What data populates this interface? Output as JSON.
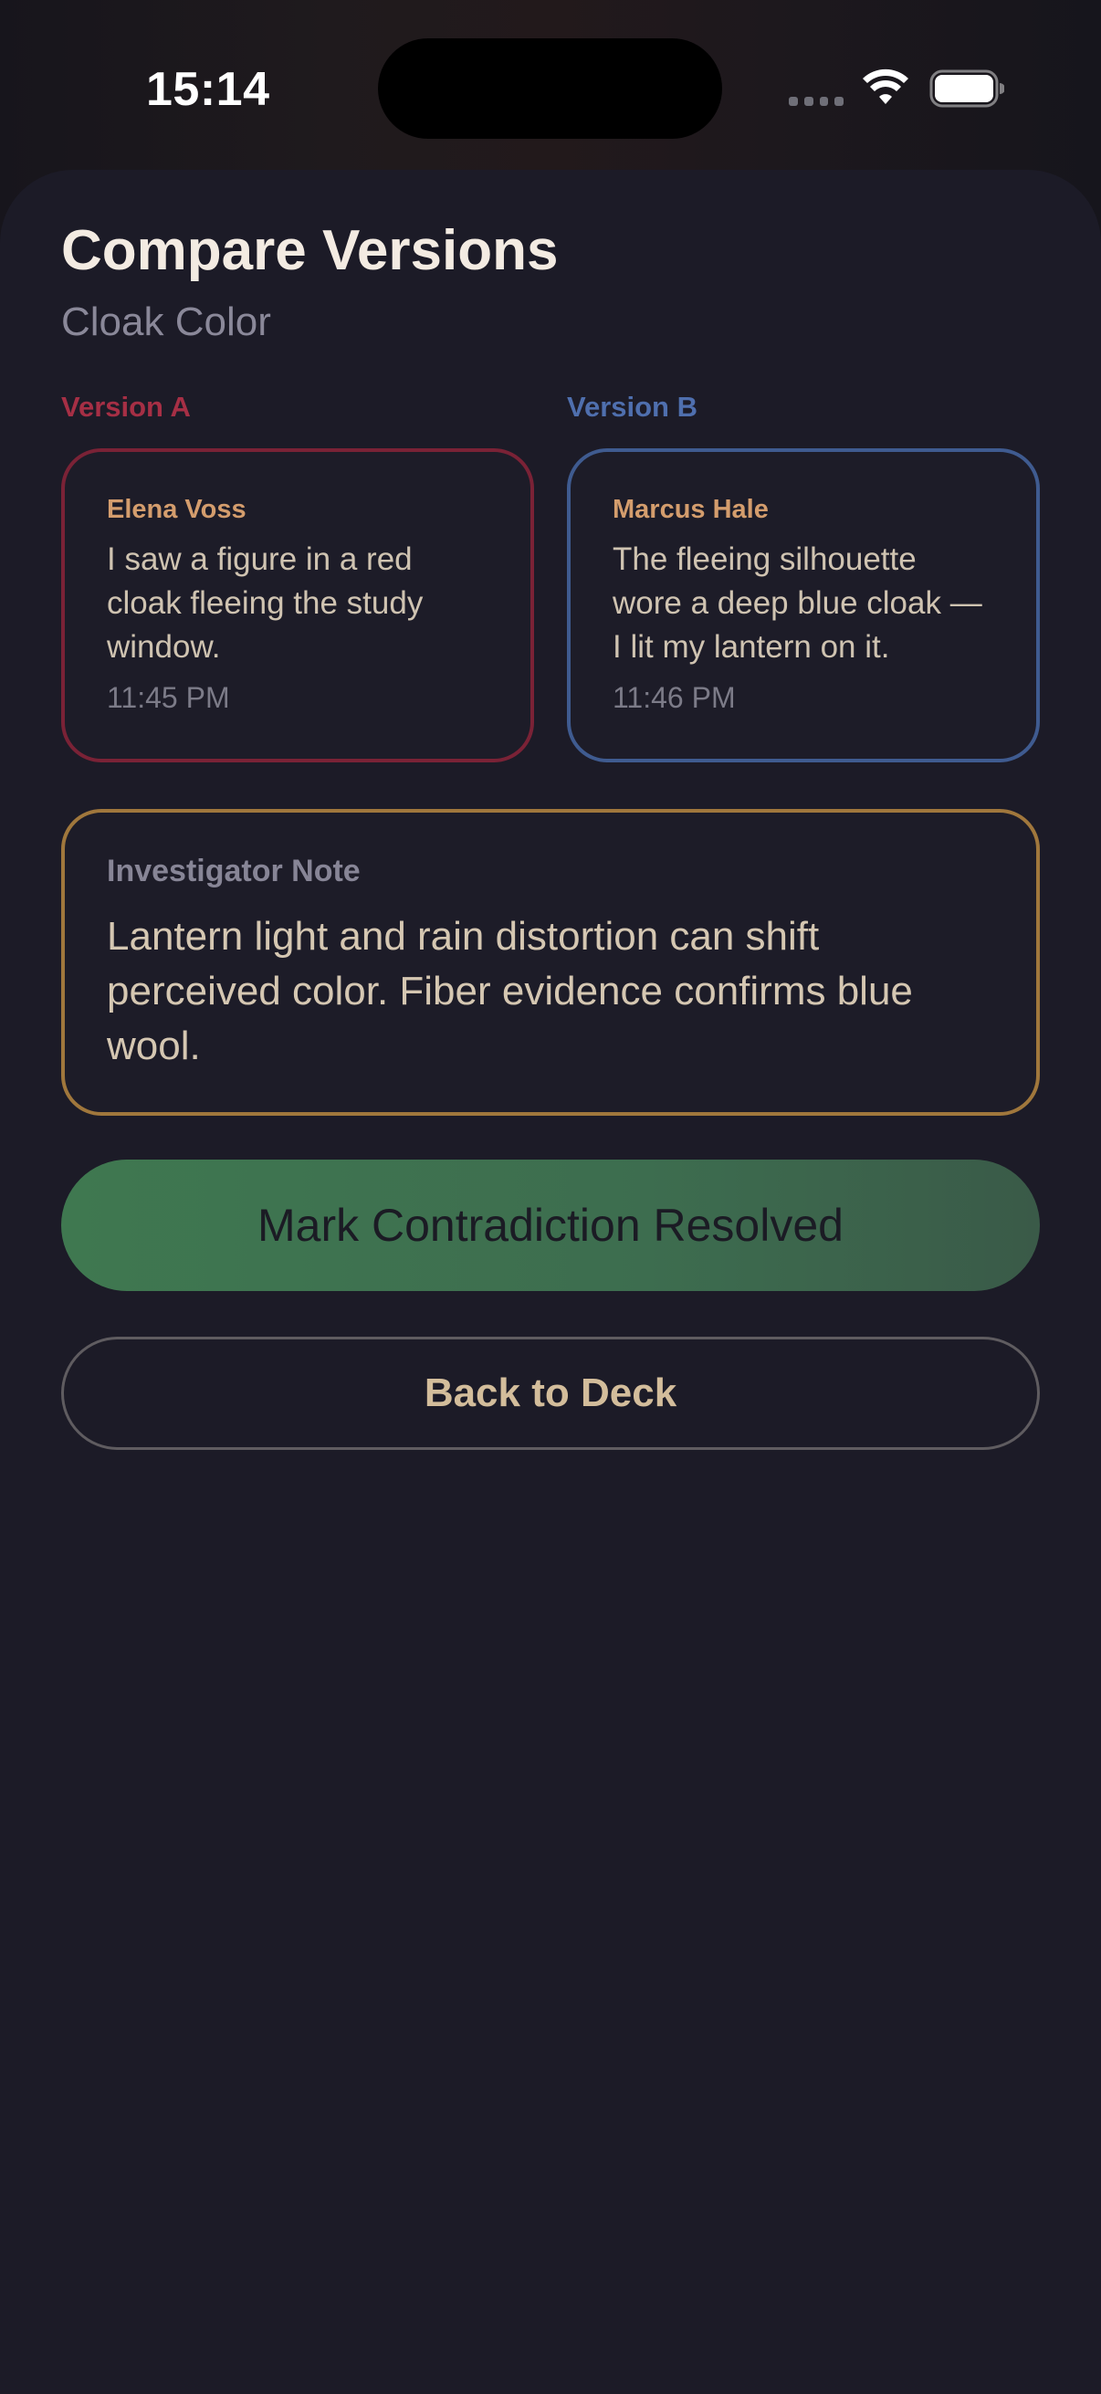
{
  "status_bar": {
    "time": "15:14"
  },
  "header": {
    "title": "Compare Versions",
    "subtitle": "Cloak Color"
  },
  "versions": {
    "a": {
      "label": "Version A",
      "color": "#a62f45",
      "witness": "Elena Voss",
      "statement": "I saw a figure in a red cloak fleeing the study window.",
      "time": "11:45 PM"
    },
    "b": {
      "label": "Version B",
      "color": "#4f6fae",
      "witness": "Marcus Hale",
      "statement": "The fleeing silhouette wore a deep blue cloak — I lit my lantern on it.",
      "time": "11:46 PM"
    }
  },
  "note": {
    "label": "Investigator Note",
    "text": "Lantern light and rain distortion can shift perceived color. Fiber evidence confirms blue wool.",
    "accent_color": "#a0773c"
  },
  "actions": {
    "resolve_label": "Mark Contradiction Resolved",
    "resolve_color": "#3f7850",
    "back_label": "Back to Deck"
  },
  "icons": {
    "cellular": "cellular-signal-icon",
    "wifi": "wifi-icon",
    "battery": "battery-icon"
  }
}
